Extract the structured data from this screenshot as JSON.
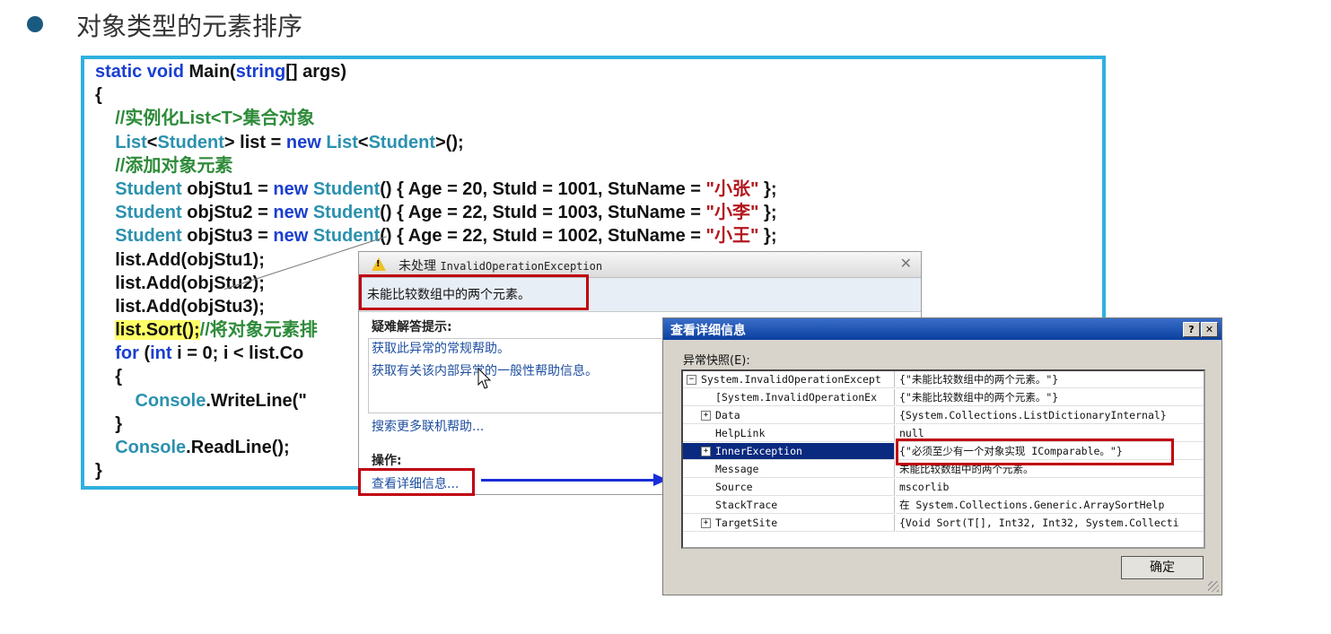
{
  "slide": {
    "title": "对象类型的元素排序"
  },
  "code": [
    [
      [
        "kw",
        "static void "
      ],
      [
        "p",
        "Main("
      ],
      [
        "kw",
        "string"
      ],
      [
        "p",
        "[] args)"
      ]
    ],
    [
      [
        "p",
        "{"
      ]
    ],
    [
      [
        "p",
        "    "
      ],
      [
        "cm",
        "//实例化List<T>集合对象"
      ]
    ],
    [
      [
        "p",
        "    "
      ],
      [
        "ty",
        "List"
      ],
      [
        "p",
        "<"
      ],
      [
        "ty",
        "Student"
      ],
      [
        "p",
        "> list = "
      ],
      [
        "kw",
        "new "
      ],
      [
        "ty",
        "List"
      ],
      [
        "p",
        "<"
      ],
      [
        "ty",
        "Student"
      ],
      [
        "p",
        ">();"
      ]
    ],
    [
      [
        "p",
        "    "
      ],
      [
        "cm",
        "//添加对象元素"
      ]
    ],
    [
      [
        "p",
        "    "
      ],
      [
        "ty",
        "Student"
      ],
      [
        "p",
        " objStu1 = "
      ],
      [
        "kw",
        "new "
      ],
      [
        "ty",
        "Student"
      ],
      [
        "p",
        "() { Age = 20, StuId = 1001, StuName = "
      ],
      [
        "str",
        "\"小张\""
      ],
      [
        "p",
        " };"
      ]
    ],
    [
      [
        "p",
        "    "
      ],
      [
        "ty",
        "Student"
      ],
      [
        "p",
        " objStu2 = "
      ],
      [
        "kw",
        "new "
      ],
      [
        "ty",
        "Student"
      ],
      [
        "p",
        "() { Age = 22, StuId = 1003, StuName = "
      ],
      [
        "str",
        "\"小李\""
      ],
      [
        "p",
        " };"
      ]
    ],
    [
      [
        "p",
        "    "
      ],
      [
        "ty",
        "Student"
      ],
      [
        "p",
        " objStu3 = "
      ],
      [
        "kw",
        "new "
      ],
      [
        "ty",
        "Student"
      ],
      [
        "p",
        "() { Age = 22, StuId = 1002, StuName = "
      ],
      [
        "str",
        "\"小王\""
      ],
      [
        "p",
        " };"
      ]
    ],
    [
      [
        "p",
        "    list.Add(objStu1);"
      ]
    ],
    [
      [
        "p",
        "    list.Add(objStu2);"
      ]
    ],
    [
      [
        "p",
        "    list.Add(objStu3);"
      ]
    ],
    [
      [
        "p",
        "    "
      ],
      [
        "hl",
        "list.Sort();"
      ],
      [
        "cm",
        "//将对象元素排"
      ]
    ],
    [
      [
        "p",
        "    "
      ],
      [
        "kw",
        "for "
      ],
      [
        "p",
        "("
      ],
      [
        "kw",
        "int "
      ],
      [
        "p",
        "i = 0; i < list.Co"
      ]
    ],
    [
      [
        "p",
        "    {"
      ]
    ],
    [
      [
        "p",
        "        "
      ],
      [
        "ty",
        "Console"
      ],
      [
        "p",
        ".WriteLine(\""
      ]
    ],
    [
      [
        "p",
        "    }"
      ]
    ],
    [
      [
        "p",
        "    "
      ],
      [
        "ty",
        "Console"
      ],
      [
        "p",
        ".ReadLine();"
      ]
    ],
    [
      [
        "p",
        "}"
      ]
    ]
  ],
  "exception_popup": {
    "title_prefix": "未处理 ",
    "title_exception": "InvalidOperationException",
    "close_glyph": "✕",
    "message": "未能比较数组中的两个元素。",
    "tips_heading": "疑难解答提示:",
    "tip_links": [
      "获取此异常的常规帮助。",
      "获取有关该内部异常的一般性帮助信息。"
    ],
    "search_link": "搜索更多联机帮助...",
    "actions_heading": "操作:",
    "details_link": "查看详细信息..."
  },
  "details_dialog": {
    "title": "查看详细信息",
    "help_button": "?",
    "close_button": "✕",
    "snapshot_label": "异常快照(E):",
    "rows": [
      {
        "expand": "−",
        "name": "System.InvalidOperationExcept",
        "value": "{\"未能比较数组中的两个元素。\"}"
      },
      {
        "expand": "",
        "name": "[System.InvalidOperationEx",
        "value": "{\"未能比较数组中的两个元素。\"}"
      },
      {
        "expand": "+",
        "name": "Data",
        "value": "{System.Collections.ListDictionaryInternal}"
      },
      {
        "expand": "",
        "name": "HelpLink",
        "value": "null"
      },
      {
        "expand": "+",
        "name": "InnerException",
        "value": "{\"必须至少有一个对象实现 IComparable。\"}"
      },
      {
        "expand": "",
        "name": "Message",
        "value": "未能比较数组中的两个元素。"
      },
      {
        "expand": "",
        "name": "Source",
        "value": "mscorlib"
      },
      {
        "expand": "",
        "name": "StackTrace",
        "value": "   在 System.Collections.Generic.ArraySortHelp"
      },
      {
        "expand": "+",
        "name": "TargetSite",
        "value": "{Void Sort(T[], Int32, Int32, System.Collecti"
      }
    ],
    "ok_button": "确定"
  }
}
